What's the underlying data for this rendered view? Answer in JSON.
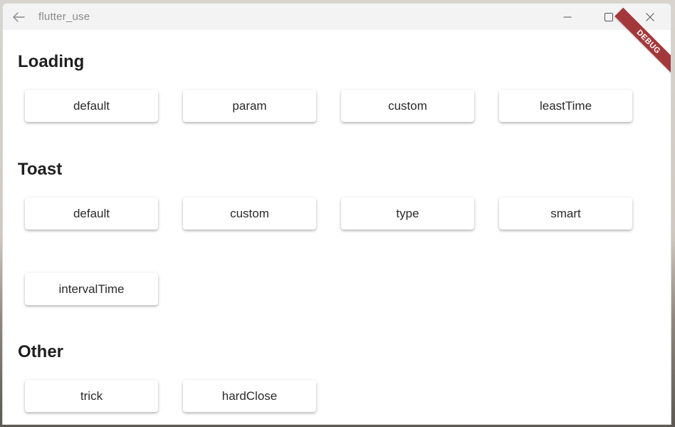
{
  "window": {
    "title": "flutter_use"
  },
  "debug_banner": "DEBUG",
  "sections": {
    "loading": {
      "title": "Loading",
      "buttons": [
        "default",
        "param",
        "custom",
        "leastTime"
      ]
    },
    "toast": {
      "title": "Toast",
      "buttons": [
        "default",
        "custom",
        "type",
        "smart",
        "intervalTime"
      ]
    },
    "other": {
      "title": "Other",
      "buttons": [
        "trick",
        "hardClose"
      ]
    }
  },
  "icons": {
    "back": "arrow-left-icon",
    "minimize": "minimize-icon",
    "maximize": "maximize-icon",
    "close": "close-icon"
  },
  "colors": {
    "titlebar": "#f3f3f3",
    "debug_ribbon": "#a3383b",
    "text": "#1f1f1f"
  }
}
